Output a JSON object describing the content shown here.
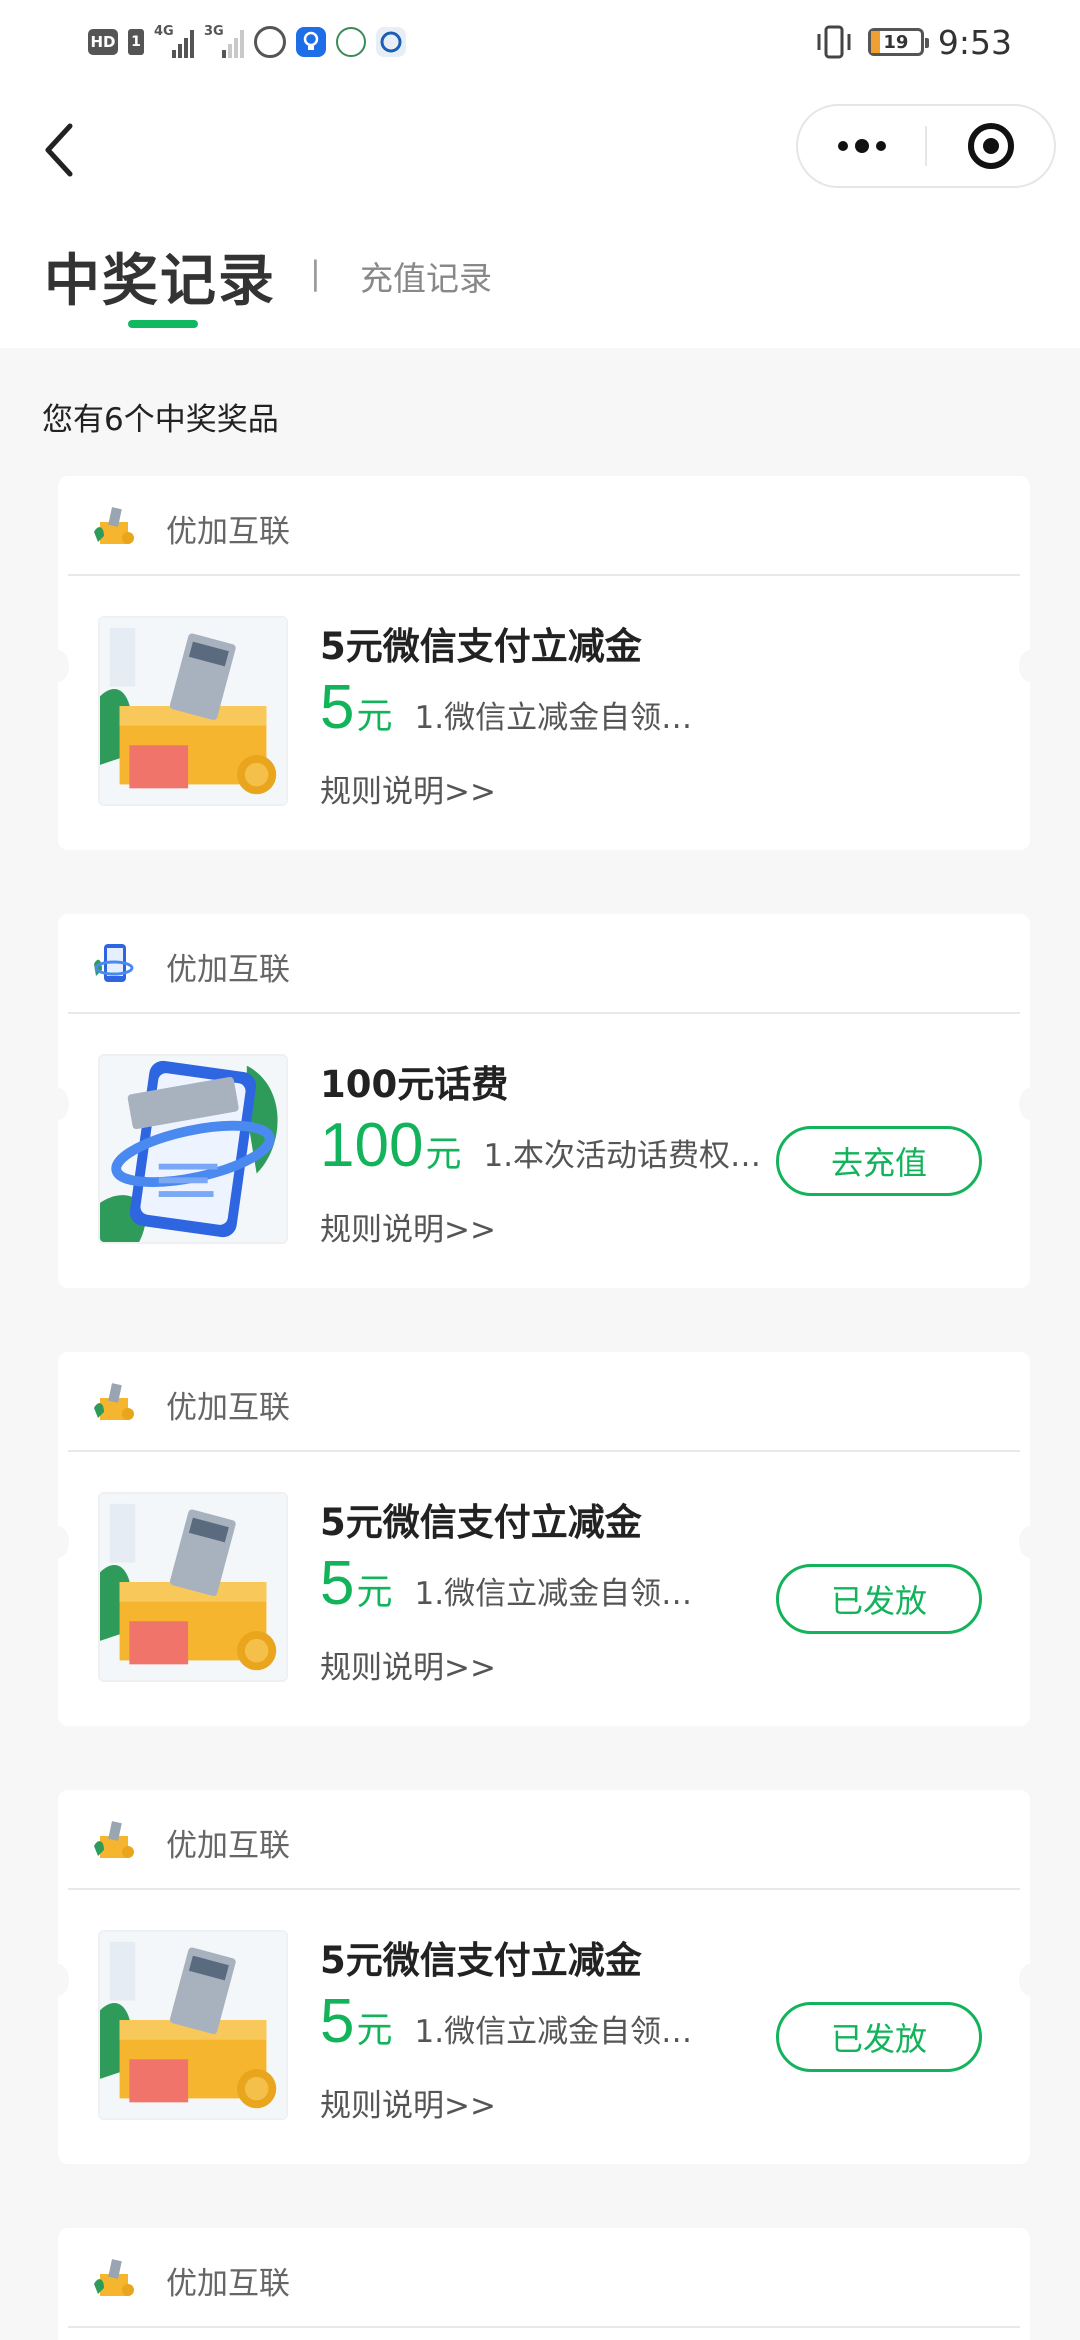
{
  "status_bar": {
    "hd": "HD",
    "sim": "1",
    "signal1_label": "4G",
    "signal2_label": "3G",
    "battery": "19",
    "battery_level": 0.19,
    "time": "9:53"
  },
  "header": {
    "back_icon": "chevron-left-icon",
    "more_icon": "more-dots-icon",
    "close_icon": "target-circle-icon"
  },
  "tabs": {
    "active": "中奖记录",
    "separator": "|",
    "inactive": "充值记录"
  },
  "summary": "您有6个中奖奖品",
  "accent_color": "#12b35a",
  "cards": [
    {
      "brand": "优加互联",
      "title": "5元微信支付立减金",
      "amount": "5",
      "unit": "元",
      "desc": "1.微信立减金自领…",
      "rules": "规则说明>>",
      "button": ""
    },
    {
      "brand": "优加互联",
      "title": "100元话费",
      "amount": "100",
      "unit": "元",
      "desc": "1.本次活动话费权…",
      "rules": "规则说明>>",
      "button": "去充值"
    },
    {
      "brand": "优加互联",
      "title": "5元微信支付立减金",
      "amount": "5",
      "unit": "元",
      "desc": "1.微信立减金自领…",
      "rules": "规则说明>>",
      "button": "已发放"
    },
    {
      "brand": "优加互联",
      "title": "5元微信支付立减金",
      "amount": "5",
      "unit": "元",
      "desc": "1.微信立减金自领…",
      "rules": "规则说明>>",
      "button": "已发放"
    },
    {
      "brand": "优加互联"
    }
  ]
}
